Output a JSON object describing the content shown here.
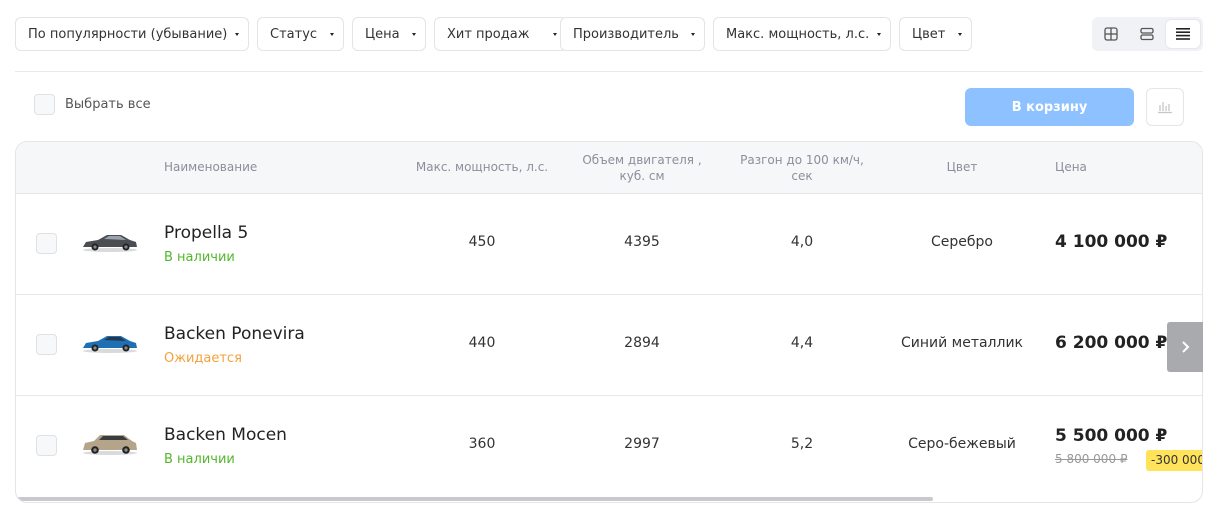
{
  "filters": [
    {
      "label": "По популярности (убывание)"
    },
    {
      "label": "Статус"
    },
    {
      "label": "Цена"
    },
    {
      "label": "Хит продаж"
    },
    {
      "label": "Производитель"
    },
    {
      "label": "Макс. мощность, л.с."
    },
    {
      "label": "Цвет"
    }
  ],
  "view_modes": [
    "grid-view-icon",
    "rows-view-icon",
    "list-view-icon"
  ],
  "active_view": "list",
  "toolbar": {
    "select_all_label": "Выбрать все",
    "cart_button_label": "В корзину",
    "compare_icon": "bar-chart-icon"
  },
  "table": {
    "headers": {
      "name": "Наименование",
      "power": "Макс. мощность, л.с.",
      "volume": "Объем двигателя , куб. см",
      "accel": "Разгон до 100 км/ч, сек",
      "color": "Цвет",
      "price": "Цена"
    },
    "rows": [
      {
        "name": "Propella 5",
        "status": "В наличии",
        "status_color": "#53b72d",
        "car_color": "#4a4d52",
        "power": "450",
        "volume": "4395",
        "accel": "4,0",
        "color": "Серебро",
        "price": "4 100 000 ₽",
        "old_price": "",
        "discount": ""
      },
      {
        "name": "Backen Ponevira",
        "status": "Ожидается",
        "status_color": "#f3a23c",
        "car_color": "#1f6fb4",
        "power": "440",
        "volume": "2894",
        "accel": "4,4",
        "color": "Синий металлик",
        "price": "6 200 000 ₽",
        "old_price": "",
        "discount": ""
      },
      {
        "name": "Backen Mocen",
        "status": "В наличии",
        "status_color": "#53b72d",
        "car_color": "#b3a48a",
        "power": "360",
        "volume": "2997",
        "accel": "5,2",
        "color": "Серо-бежевый",
        "price": "5 500 000 ₽",
        "old_price": "5 800 000 ₽",
        "discount": "-300 000"
      }
    ]
  },
  "colors": {
    "accent": "#8ec1ff",
    "in_stock": "#53b72d",
    "expected": "#f3a23c",
    "discount_badge": "#ffe35a"
  }
}
